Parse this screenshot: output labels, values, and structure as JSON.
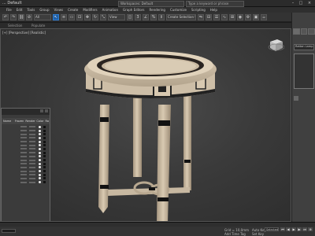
{
  "titlebar": {
    "title": "... Default",
    "workspace": "Workspaces: Default",
    "search": "Type a keyword or phrase",
    "minimize": "–",
    "maximize": "□",
    "close": "×"
  },
  "menu": [
    "File",
    "Edit",
    "Tools",
    "Group",
    "Views",
    "Create",
    "Modifiers",
    "Animation",
    "Graph Editors",
    "Rendering",
    "Customize",
    "Scripting",
    "Help"
  ],
  "toolbar": {
    "selection_filter": "All",
    "view_dropdown": "View",
    "named_selection": "Create Selection Set"
  },
  "ribbon": {
    "left_label": "Selection",
    "mid_label": "Populate"
  },
  "viewport": {
    "label": "[+] [Perspective] [Realistic]"
  },
  "scene_explorer": {
    "columns": [
      "Name",
      "Frozen",
      "Render",
      "Color",
      "Ra"
    ],
    "row_count": 16
  },
  "command_panel": {
    "object_name": "Rattan Lamp"
  },
  "status": {
    "left": "",
    "x_label": "X:",
    "grid": "Grid = 10,0mm",
    "add_time_tag": "Add Time Tag",
    "autokey_label": "Auto Key",
    "autokey_value": "Selected",
    "setkey_label": "Set Key",
    "key_filters": "Key Filters..."
  }
}
